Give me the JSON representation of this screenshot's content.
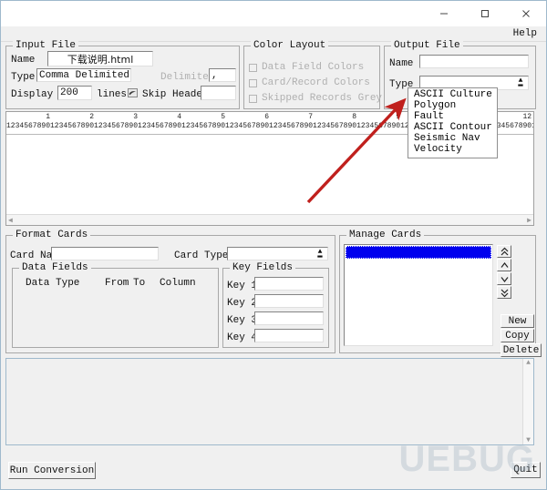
{
  "window": {
    "minimize_label": "minimize",
    "maximize_label": "maximize",
    "close_label": "close"
  },
  "menu": {
    "help_label": "Help"
  },
  "input_file": {
    "group_title": "Input File",
    "name_label": "Name",
    "name_value": "下载说明.html",
    "type_label": "Type",
    "type_value": "Comma Delimited",
    "delimiter_label": "Delimiter",
    "delimiter_value": ",",
    "display_label": "Display",
    "display_value": "200",
    "lines_label": "lines",
    "skip_headers_label": "Skip Headers",
    "skip_headers_value": ""
  },
  "color_layout": {
    "group_title": "Color Layout",
    "options": [
      {
        "label": "Data Field Colors",
        "checked": false
      },
      {
        "label": "Card/Record Colors",
        "checked": false
      },
      {
        "label": "Skipped Records Grey",
        "checked": false
      }
    ]
  },
  "output_file": {
    "group_title": "Output File",
    "name_label": "Name",
    "name_value": "",
    "type_label": "Type",
    "type_value": "",
    "type_options": [
      "ASCII Culture",
      "Polygon",
      "Fault",
      "ASCII Contour",
      "Seismic Nav",
      "Velocity"
    ]
  },
  "preview": {
    "ruler_numbers": "         1         2         3         4         5         6         7         8         9        10        11        12",
    "ruler_digits": "123456789012345678901234567890123456789012345678901234567890123456789012345678901234567890123456789012345678901234567890123456",
    "body_text": ""
  },
  "format_cards": {
    "group_title": "Format Cards",
    "card_name_label": "Card Name",
    "card_name_value": "",
    "card_type_label": "Card Type",
    "card_type_value": "",
    "data_fields": {
      "group_title": "Data Fields",
      "columns": [
        "Data Type",
        "From",
        "To",
        "Column"
      ],
      "rows": []
    },
    "key_fields": {
      "group_title": "Key Fields",
      "keys": [
        {
          "label": "Key 1",
          "value": ""
        },
        {
          "label": "Key 2",
          "value": ""
        },
        {
          "label": "Key 3",
          "value": ""
        },
        {
          "label": "Key 4",
          "value": ""
        }
      ]
    }
  },
  "manage_cards": {
    "group_title": "Manage Cards",
    "items": [
      ""
    ],
    "selected_index": 0,
    "selection_color": "#0000ee",
    "order_buttons": [
      {
        "name": "move-top",
        "glyph": "»"
      },
      {
        "name": "move-up",
        "glyph": "›"
      },
      {
        "name": "move-down",
        "glyph": "‹"
      },
      {
        "name": "move-bottom",
        "glyph": "«"
      }
    ],
    "new_label": "New",
    "copy_label": "Copy",
    "delete_label": "Delete"
  },
  "footer": {
    "run_label": "Run Conversion",
    "quit_label": "Quit"
  },
  "annotation": {
    "arrow_color": "#c0201d",
    "arrow_name": "red-pointer-arrow"
  },
  "watermark": {
    "text": "UEBUG"
  }
}
